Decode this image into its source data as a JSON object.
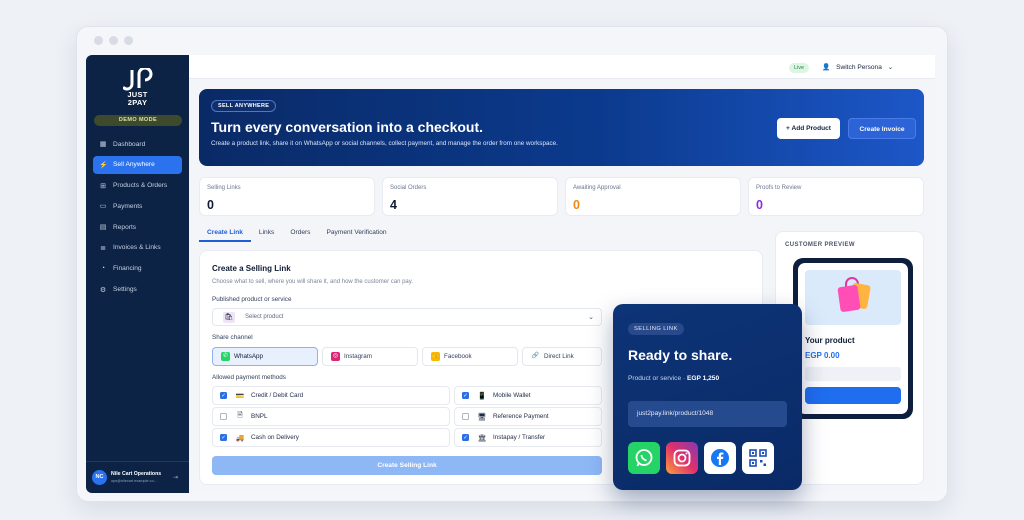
{
  "brand": {
    "name_line1": "JUST",
    "name_line2": "2PAY",
    "mode_badge": "DEMO MODE"
  },
  "sidebar": {
    "items": [
      {
        "label": "Dashboard",
        "icon": "grid-icon"
      },
      {
        "label": "Sell Anywhere",
        "icon": "bolt-icon",
        "active": true
      },
      {
        "label": "Products & Orders",
        "icon": "cart-icon"
      },
      {
        "label": "Payments",
        "icon": "card-icon"
      },
      {
        "label": "Reports",
        "icon": "chart-icon"
      },
      {
        "label": "Invoices & Links",
        "icon": "invoice-icon"
      },
      {
        "label": "Financing",
        "icon": "financing-icon"
      },
      {
        "label": "Settings",
        "icon": "gear-icon"
      }
    ],
    "user": {
      "initials": "NC",
      "name": "Nile Cart Operations",
      "email": "ops@nilecart.example.co..."
    }
  },
  "topbar": {
    "live_label": "Live",
    "persona_label": "Switch Persona"
  },
  "hero": {
    "badge": "SELL ANYWHERE",
    "title": "Turn every conversation into a checkout.",
    "description": "Create a product link, share it on WhatsApp or social channels, collect payment, and manage the order from one workspace.",
    "add_product": "+ Add Product",
    "create_invoice": "Create Invoice"
  },
  "stats": [
    {
      "label": "Selling Links",
      "value": "0",
      "color": "#0f1b33"
    },
    {
      "label": "Social Orders",
      "value": "4",
      "color": "#0f1b33"
    },
    {
      "label": "Awaiting Approval",
      "value": "0",
      "color": "#f08a12"
    },
    {
      "label": "Proofs to Review",
      "value": "0",
      "color": "#8a2be2"
    }
  ],
  "tabs": [
    "Create Link",
    "Links",
    "Orders",
    "Payment Verification"
  ],
  "form": {
    "title": "Create a Selling Link",
    "subtitle": "Choose what to sell, where you will share it, and how the customer can pay.",
    "product_label": "Published product or service",
    "product_placeholder": "Select product",
    "channel_label": "Share channel",
    "channels": [
      "WhatsApp",
      "Instagram",
      "Facebook",
      "Direct Link"
    ],
    "payment_label": "Allowed payment methods",
    "payments": [
      {
        "label": "Credit / Debit Card",
        "checked": true
      },
      {
        "label": "Mobile Wallet",
        "checked": true
      },
      {
        "label": "BNPL",
        "checked": false
      },
      {
        "label": "Reference Payment",
        "checked": false
      },
      {
        "label": "Cash on Delivery",
        "checked": true
      },
      {
        "label": "Instapay / Transfer",
        "checked": true
      }
    ],
    "submit": "Create Selling Link"
  },
  "preview": {
    "title": "CUSTOMER PREVIEW",
    "product_name": "Your product",
    "price": "EGP 0.00"
  },
  "share_card": {
    "badge": "SELLING LINK",
    "title": "Ready to share.",
    "product_prefix": "Product or service · ",
    "product_price": "EGP 1,250",
    "link": "just2pay.link/product/1048"
  }
}
